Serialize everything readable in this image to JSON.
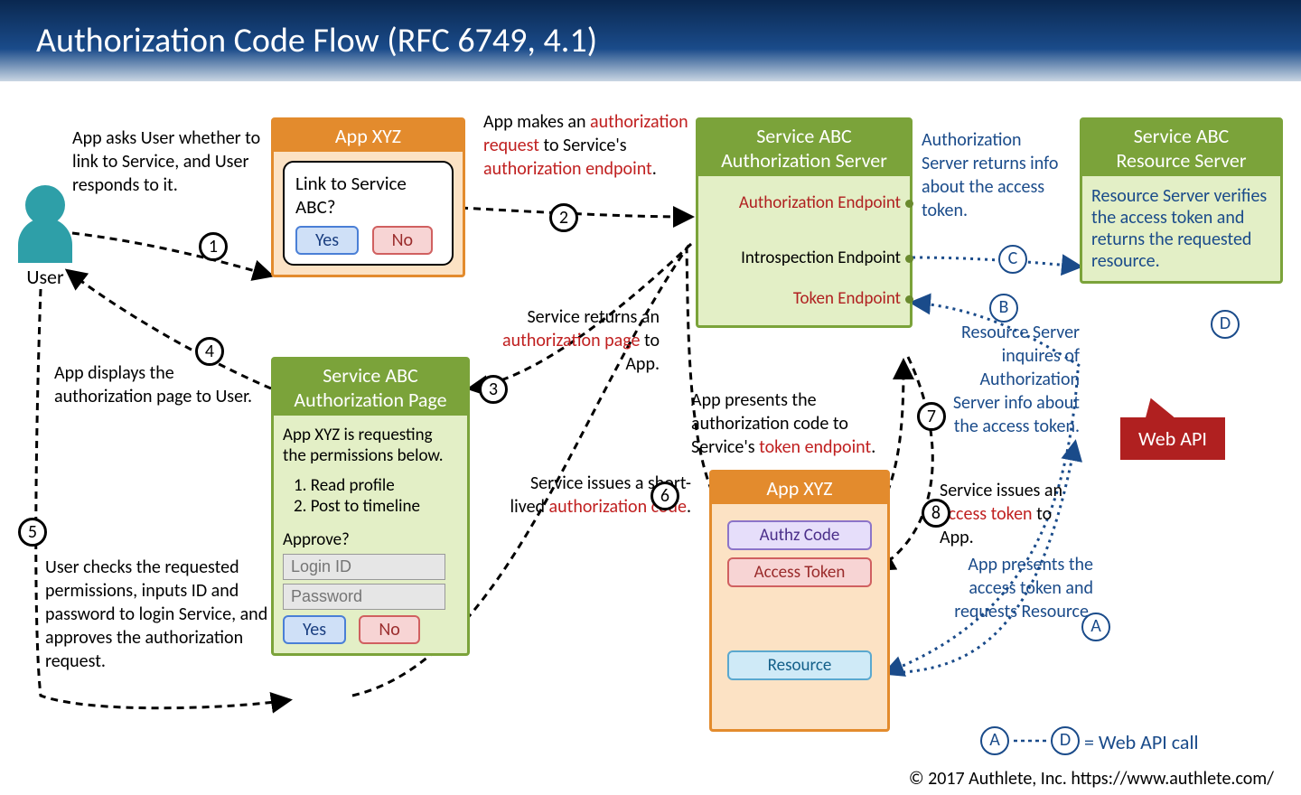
{
  "title": "Authorization Code Flow   (RFC 6749, 4.1)",
  "user_label": "User",
  "app_box": {
    "header": "App XYZ",
    "prompt": "Link to Service ABC?",
    "yes": "Yes",
    "no": "No"
  },
  "authz_page": {
    "header_l1": "Service ABC",
    "header_l2": "Authorization Page",
    "intro": "App XYZ is requesting the permissions below.",
    "perm1": "1. Read profile",
    "perm2": "2. Post to timeline",
    "approve": "Approve?",
    "login_placeholder": "Login ID",
    "password_placeholder": "Password",
    "yes": "Yes",
    "no": "No"
  },
  "authz_server": {
    "header_l1": "Service ABC",
    "header_l2": "Authorization Server",
    "authz_endpoint": "Authorization Endpoint",
    "introspection_endpoint": "Introspection Endpoint",
    "token_endpoint": "Token Endpoint"
  },
  "app_box2": {
    "header": "App XYZ",
    "authz_code": "Authz Code",
    "access_token": "Access Token",
    "resource": "Resource"
  },
  "resource_server": {
    "header_l1": "Service ABC",
    "header_l2": "Resource Server",
    "desc": "Resource Server verifies the access token and returns the requested resource."
  },
  "annotations": {
    "a1": "App asks User whether to link to Service, and User responds to it.",
    "a2_pre": "App makes an ",
    "a2_red1": "authorization request",
    "a2_mid": " to Service's ",
    "a2_red2": "authorization endpoint",
    "a2_post": ".",
    "a3_pre": "Service returns an ",
    "a3_red": "authorization page",
    "a3_post": " to App.",
    "a4": "App displays the authorization page to User.",
    "a5": "User checks the requested permissions, inputs ID and password to login Service, and approves the authorization request.",
    "a6_pre": "Service issues a short-lived ",
    "a6_red": "authorization code",
    "a6_post": ".",
    "a7_pre": "App presents the authorization code to Service's ",
    "a7_red": "token endpoint",
    "a7_post": ".",
    "a8_pre": "Service issues an ",
    "a8_red": "access token",
    "a8_post": " to App.",
    "aA": "App presents the access token and requests Resource.",
    "aB": "Resource Server inquires of Authorization Server info about the access token.",
    "aC": "Authorization Server returns info about the access token.",
    "legend": " = Web API call"
  },
  "webapi_label": "Web API",
  "footer": "© 2017 Authlete, Inc.  https://www.authlete.com/",
  "steps": {
    "s1": "1",
    "s2": "2",
    "s3": "3",
    "s4": "4",
    "s5": "5",
    "s6": "6",
    "s7": "7",
    "s8": "8"
  },
  "letters": {
    "A": "A",
    "B": "B",
    "C": "C",
    "D": "D"
  }
}
